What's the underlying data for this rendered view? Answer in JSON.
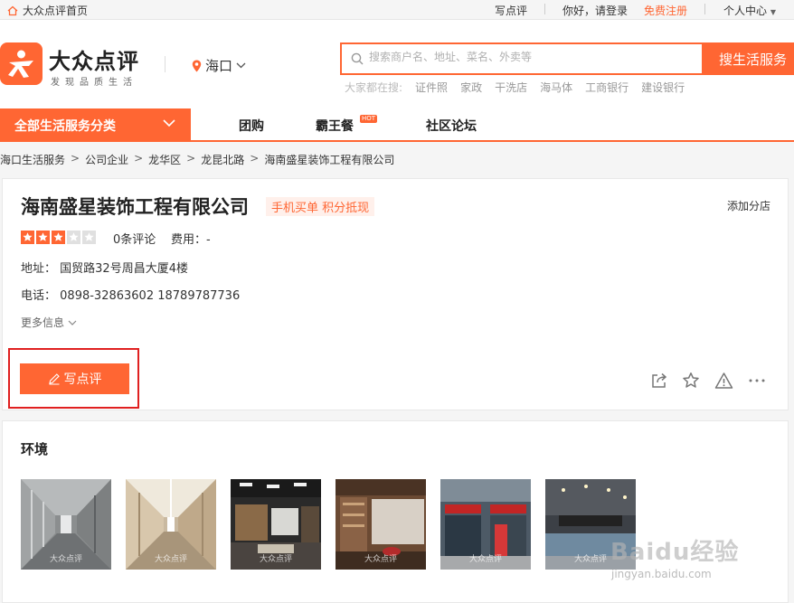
{
  "topbar": {
    "home": "大众点评首页",
    "write_review": "写点评",
    "greeting": "你好，请登录",
    "register": "免费注册",
    "account": "个人中心"
  },
  "logo": {
    "title": "大众点评",
    "subtitle": "发现品质生活"
  },
  "city": "海口",
  "search": {
    "placeholder": "搜索商户名、地址、菜名、外卖等",
    "button": "搜生活服务",
    "hot_label": "大家都在搜:",
    "hot": [
      "证件照",
      "家政",
      "干洗店",
      "海马体",
      "工商银行",
      "建设银行"
    ]
  },
  "nav": {
    "all": "全部生活服务分类",
    "items": [
      "团购",
      "霸王餐",
      "社区论坛"
    ],
    "hot_badge": "HOT"
  },
  "breadcrumb": [
    "海口生活服务",
    "公司企业",
    "龙华区",
    "龙昆北路",
    "海南盛星装饰工程有限公司"
  ],
  "shop": {
    "name": "海南盛星装饰工程有限公司",
    "tag": "手机买单 积分抵现",
    "add_branch": "添加分店",
    "rating": 3,
    "reviews": "0条评论",
    "cost": "费用：-",
    "address_label": "地址：",
    "address": "国贸路32号周昌大厦4楼",
    "phone_label": "电话：",
    "phone": "0898-32863602 18789787736",
    "more": "更多信息",
    "write_review": "写点评"
  },
  "environment": {
    "title": "环境",
    "photo_watermark": "大众点评"
  },
  "watermark": {
    "brand": "Baidu经验",
    "url": "jingyan.baidu.com"
  },
  "colors": {
    "accent": "#ff6633",
    "highlight_box": "#e02020"
  }
}
